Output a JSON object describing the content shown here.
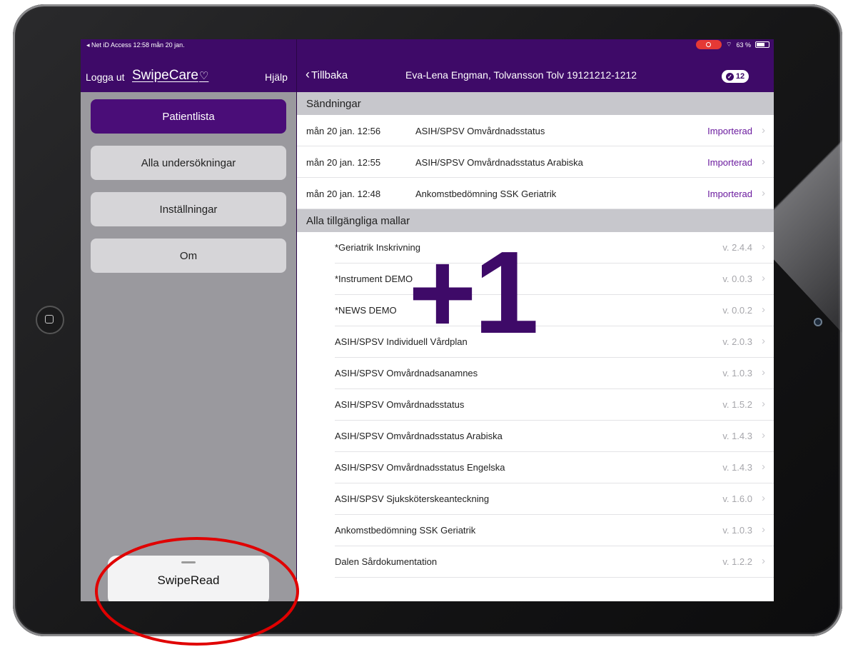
{
  "status_bar": {
    "left": "◂ Net iD Access  12:58  mån 20 jan.",
    "battery": "63 %"
  },
  "sidebar": {
    "logout": "Logga ut",
    "logo": "SwipeCare",
    "help": "Hjälp",
    "items": [
      {
        "label": "Patientlista",
        "active": true
      },
      {
        "label": "Alla undersökningar",
        "active": false
      },
      {
        "label": "Inställningar",
        "active": false
      },
      {
        "label": "Om",
        "active": false
      }
    ],
    "swiperead": "SwipeRead"
  },
  "detail_header": {
    "back": "Tillbaka",
    "patient": "Eva-Lena Engman, Tolvansson Tolv  19121212-1212",
    "badge_count": "12"
  },
  "sendings": {
    "title": "Sändningar",
    "rows": [
      {
        "date": "mån 20 jan. 12:56",
        "name": "ASIH/SPSV Omvårdnadsstatus",
        "status": "Importerad"
      },
      {
        "date": "mån 20 jan. 12:55",
        "name": "ASIH/SPSV Omvårdnadsstatus Arabiska",
        "status": "Importerad"
      },
      {
        "date": "mån 20 jan. 12:48",
        "name": "Ankomstbedömning SSK Geriatrik",
        "status": "Importerad"
      }
    ]
  },
  "templates": {
    "title": "Alla tillgängliga mallar",
    "rows": [
      {
        "name": "*Geriatrik Inskrivning",
        "version": "v. 2.4.4"
      },
      {
        "name": "*Instrument DEMO",
        "version": "v. 0.0.3"
      },
      {
        "name": "*NEWS DEMO",
        "version": "v. 0.0.2"
      },
      {
        "name": "ASIH/SPSV Individuell Vårdplan",
        "version": "v. 2.0.3"
      },
      {
        "name": "ASIH/SPSV Omvårdnadsanamnes",
        "version": "v. 1.0.3"
      },
      {
        "name": "ASIH/SPSV Omvårdnadsstatus",
        "version": "v. 1.5.2"
      },
      {
        "name": "ASIH/SPSV Omvårdnadsstatus Arabiska",
        "version": "v. 1.4.3"
      },
      {
        "name": "ASIH/SPSV Omvårdnadsstatus Engelska",
        "version": "v. 1.4.3"
      },
      {
        "name": "ASIH/SPSV Sjuksköterskeanteckning",
        "version": "v. 1.6.0"
      },
      {
        "name": "Ankomstbedömning SSK Geriatrik",
        "version": "v. 1.0.3"
      },
      {
        "name": "Dalen Sårdokumentation",
        "version": "v. 1.2.2"
      }
    ]
  },
  "overlay": {
    "plus_one": "+1"
  },
  "colors": {
    "brand": "#3e0a68",
    "status": "#6a1a9e",
    "annotation": "#e00000"
  }
}
